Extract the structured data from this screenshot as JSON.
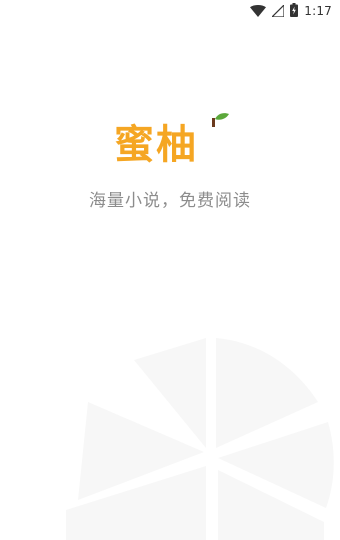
{
  "status_bar": {
    "time": "1:17",
    "icons": [
      "wifi-icon",
      "cellular-signal-icon",
      "battery-charging-icon"
    ]
  },
  "splash": {
    "logo_text": "蜜柚",
    "slogan": "海量小说，免费阅读"
  },
  "colors": {
    "brand_orange": "#F5A623",
    "leaf_green": "#5BA83A",
    "slogan_gray": "#8C8C8C",
    "watermark": "#F7F7F7"
  }
}
